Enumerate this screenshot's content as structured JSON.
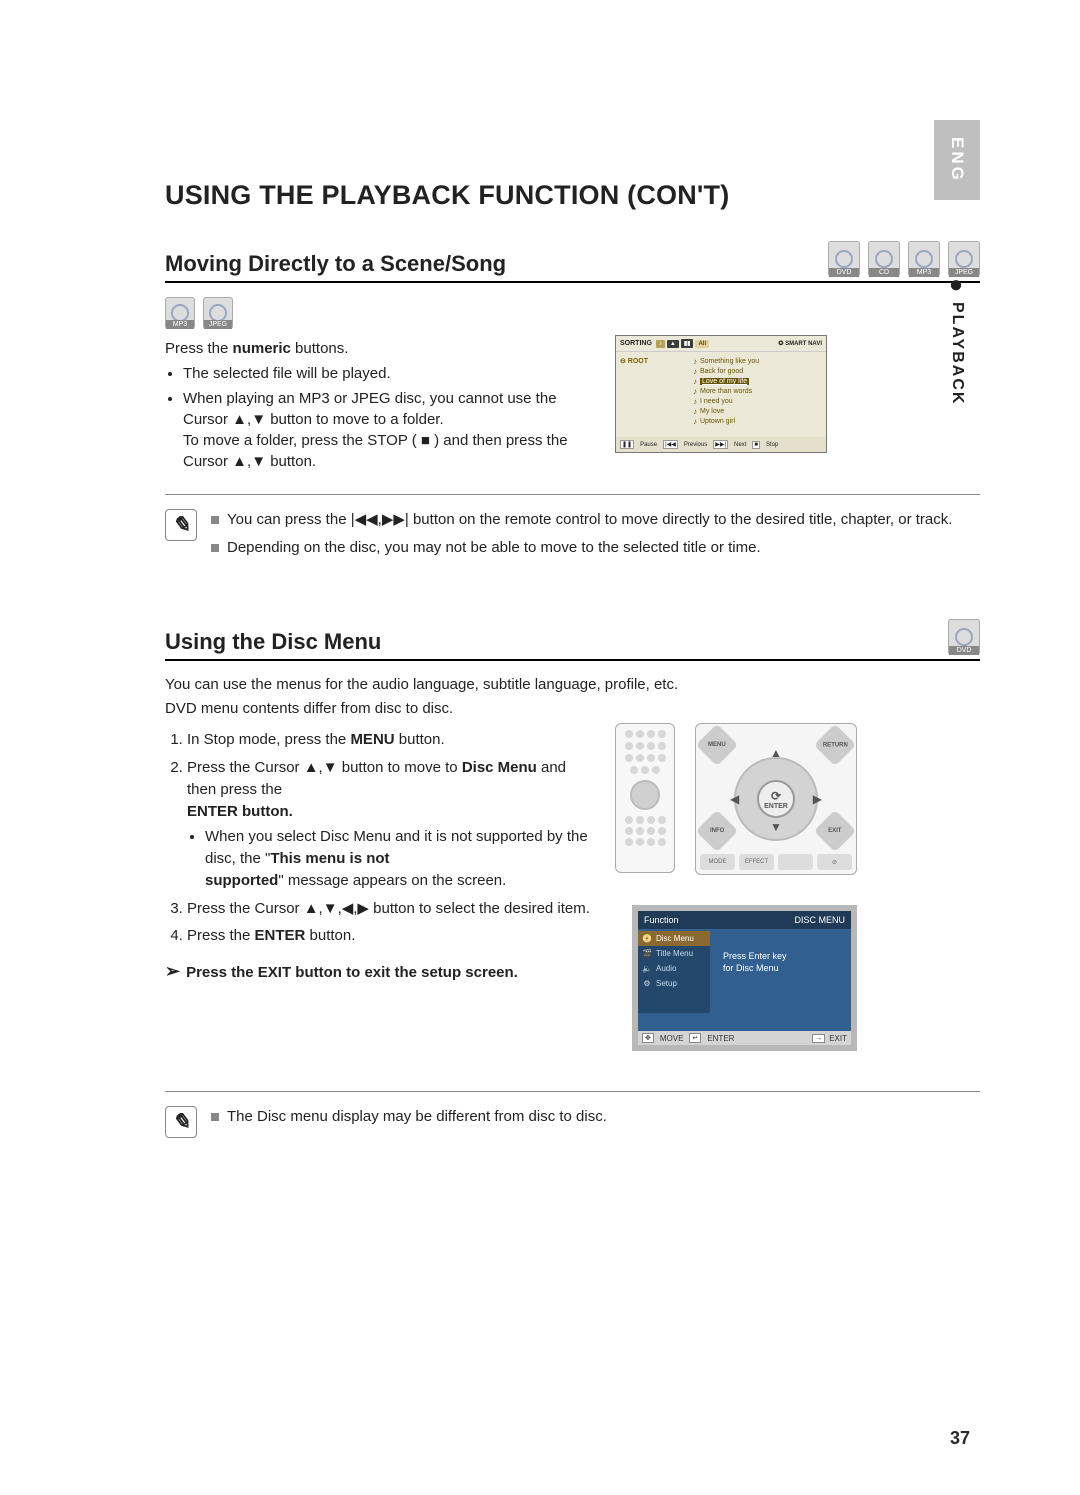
{
  "page_number": "37",
  "lang_tab": "ENG",
  "side_section": "PLAYBACK",
  "title": "USING THE PLAYBACK FUNCTION (CON'T)",
  "section1": {
    "heading": "Moving Directly to a Scene/Song",
    "header_icons": [
      "DVD",
      "CD",
      "MP3",
      "JPEG"
    ],
    "sub_icons": [
      "MP3",
      "JPEG"
    ],
    "intro": "Press the numeric buttons.",
    "bullet1": "The selected file will be played.",
    "bullet2_a": "When playing an MP3 or JPEG disc, you cannot use the Cursor ▲,▼ button to move to a folder.",
    "bullet2_b": "To move a folder, press the STOP ( ■ ) and then press the Cursor ▲,▼ button.",
    "notes": {
      "n1": "You can press the |◀◀,▶▶| button on the remote control to move directly to the desired title, chapter, or track.",
      "n2": "Depending on the disc, you may not be able to move to the selected title or time."
    },
    "smartnavi": {
      "sorting_label": "SORTING",
      "smart_label": "✪ SMART NAVI",
      "root_label": "⊖ ROOT",
      "songs": [
        "Something like you",
        "Back for good",
        "Love of my life",
        "More than words",
        "I need you",
        "My love",
        "Uptown girl"
      ],
      "selected_index": 2,
      "footer": {
        "pause": "Pause",
        "previous": "Previous",
        "next": "Next",
        "stop": "Stop"
      }
    }
  },
  "section2": {
    "heading": "Using the Disc Menu",
    "header_icons": [
      "DVD"
    ],
    "intro1": "You can use the menus for the audio language, subtitle language, profile, etc.",
    "intro2": "DVD menu contents differ from disc to disc.",
    "step1": "In Stop mode, press the MENU button.",
    "step2_a": "Press the Cursor ▲,▼ button to move to Disc Menu and then press the",
    "step2_b": "ENTER button.",
    "step2_sub_a": "When you select Disc Menu and it is not supported by the disc, the \"This menu is not",
    "step2_sub_b": "supported\" message appears on the screen.",
    "step3": "Press the Cursor ▲,▼,◀,▶ button to select the desired item.",
    "step4": "Press the ENTER button.",
    "exit_line": "Press the EXIT button to exit the setup screen.",
    "dpad": {
      "enter": "ENTER",
      "tl": "MENU",
      "tr": "RETURN",
      "bl": "INFO",
      "br": "EXIT",
      "foot": [
        "MODE",
        "EFFECT",
        "",
        ""
      ]
    },
    "osd": {
      "top_left": "Function",
      "top_right": "DISC MENU",
      "menu_items": [
        "Disc Menu",
        "Title Menu",
        "Audio",
        "Setup"
      ],
      "msg_line1": "Press Enter key",
      "msg_line2": "for Disc Menu",
      "footer": {
        "move": "MOVE",
        "enter": "ENTER",
        "exit": "EXIT"
      }
    },
    "note": "The Disc menu display may be different from disc to disc."
  }
}
